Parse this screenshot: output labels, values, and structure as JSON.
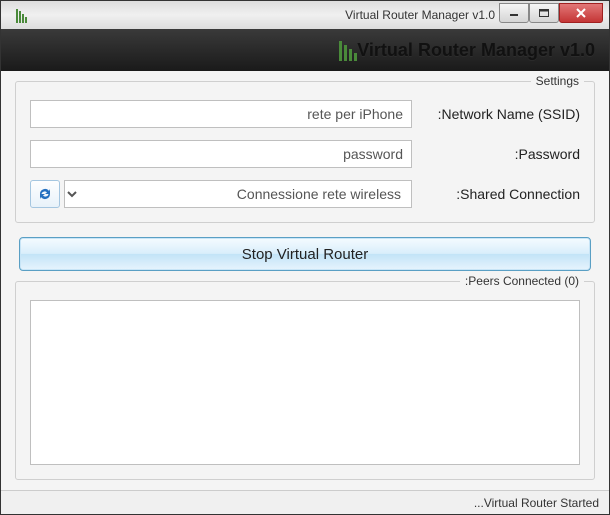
{
  "window": {
    "title": "Virtual Router Manager v1.0"
  },
  "header": {
    "title": "Virtual Router Manager v1.0"
  },
  "settings": {
    "group_title": "Settings",
    "ssid_label": "Network Name (SSID):",
    "ssid_value": "rete per iPhone",
    "password_label": "Password:",
    "password_value": "password",
    "shared_label": "Shared Connection:",
    "shared_value": "Connessione rete wireless"
  },
  "actions": {
    "stop_label": "Stop Virtual Router"
  },
  "peers": {
    "group_title": "Peers Connected (0):",
    "count": 0,
    "items": []
  },
  "status": {
    "text": "Virtual Router Started..."
  },
  "icons": {
    "app": "wifi-bars-icon",
    "refresh": "refresh-icon",
    "minimize": "minimize-icon",
    "maximize": "maximize-icon",
    "close": "close-icon"
  }
}
